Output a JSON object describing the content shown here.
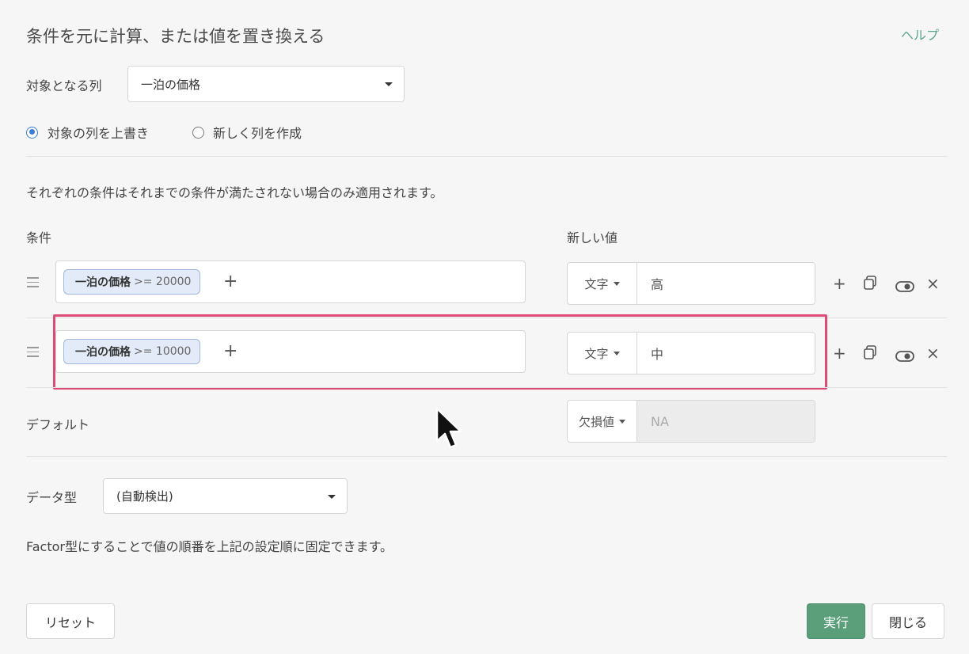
{
  "dialog": {
    "title": "条件を元に計算、または値を置き換える",
    "help_label": "ヘルプ"
  },
  "target_column": {
    "label": "対象となる列",
    "value": "一泊の価格"
  },
  "output_mode": {
    "overwrite_label": "対象の列を上書き",
    "overwrite_selected": true,
    "new_column_label": "新しく列を作成",
    "new_column_selected": false
  },
  "info_text": "それぞれの条件はそれまでの条件が満たされない場合のみ適用されます。",
  "headers": {
    "condition": "条件",
    "new_value": "新しい値"
  },
  "rules": [
    {
      "column": "一泊の価格",
      "expression": ">= 20000",
      "type": "文字",
      "value": "高"
    },
    {
      "column": "一泊の価格",
      "expression": ">= 10000",
      "type": "文字",
      "value": "中"
    }
  ],
  "add_condition_symbol": "+",
  "default_row": {
    "label": "デフォルト",
    "type": "欠損値",
    "value": "NA"
  },
  "data_type": {
    "label": "データ型",
    "value": "(自動検出)"
  },
  "factor_note": "Factor型にすることで値の順番を上記の設定順に固定できます。",
  "footer": {
    "reset_label": "リセット",
    "run_label": "実行",
    "close_label": "閉じる"
  },
  "colors": {
    "accent_green": "#5a9e7a",
    "highlight": "#dc4a75",
    "chip_bg": "#e3ebf8",
    "radio_blue": "#3b7dd8"
  },
  "icons": [
    "drag-handle-icon",
    "plus-icon",
    "copy-icon",
    "eye-icon",
    "close-icon",
    "caret-down-icon",
    "mouse-cursor-icon"
  ]
}
